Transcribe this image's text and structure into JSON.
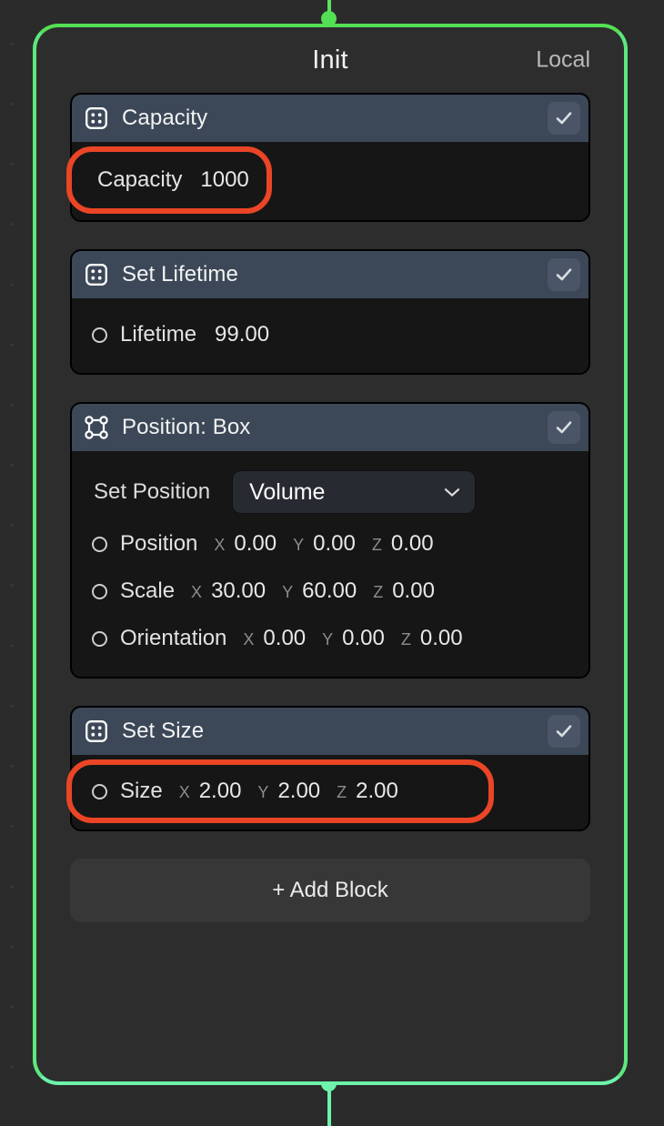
{
  "node": {
    "title": "Init",
    "space": "Local",
    "accent_top": "#54e054",
    "accent_bottom": "#6df3ac",
    "header_color": "#3c4858",
    "body_color": "#161616",
    "highlight_color": "#ea4526"
  },
  "blocks": [
    {
      "icon": "block-dots-icon",
      "title": "Capacity",
      "enabled_icon": "check-icon",
      "highlighted": true,
      "rows": [
        {
          "kind": "scalar-noport",
          "label": "Capacity",
          "value": "1000"
        }
      ]
    },
    {
      "icon": "block-dots-icon",
      "title": "Set Lifetime",
      "enabled_icon": "check-icon",
      "highlighted": false,
      "rows": [
        {
          "kind": "scalar",
          "label": "Lifetime",
          "value": "99.00"
        }
      ]
    },
    {
      "icon": "transform-gizmo-icon",
      "title": "Position: Box",
      "enabled_icon": "check-icon",
      "highlighted": false,
      "dropdown": {
        "label": "Set Position",
        "value": "Volume",
        "chevron": "chevron-down-icon"
      },
      "rows": [
        {
          "kind": "vector3",
          "label": "Position",
          "x": "0.00",
          "y": "0.00",
          "z": "0.00"
        },
        {
          "kind": "vector3",
          "label": "Scale",
          "x": "30.00",
          "y": "60.00",
          "z": "0.00"
        },
        {
          "kind": "vector3",
          "label": "Orientation",
          "x": "0.00",
          "y": "0.00",
          "z": "0.00"
        }
      ]
    },
    {
      "icon": "block-dots-icon",
      "title": "Set Size",
      "enabled_icon": "check-icon",
      "highlighted": true,
      "rows": [
        {
          "kind": "vector3",
          "label": "Size",
          "x": "2.00",
          "y": "2.00",
          "z": "2.00"
        }
      ]
    }
  ],
  "axis_labels": {
    "x": "X",
    "y": "Y",
    "z": "Z"
  },
  "add_block": {
    "label": "+ Add Block"
  }
}
